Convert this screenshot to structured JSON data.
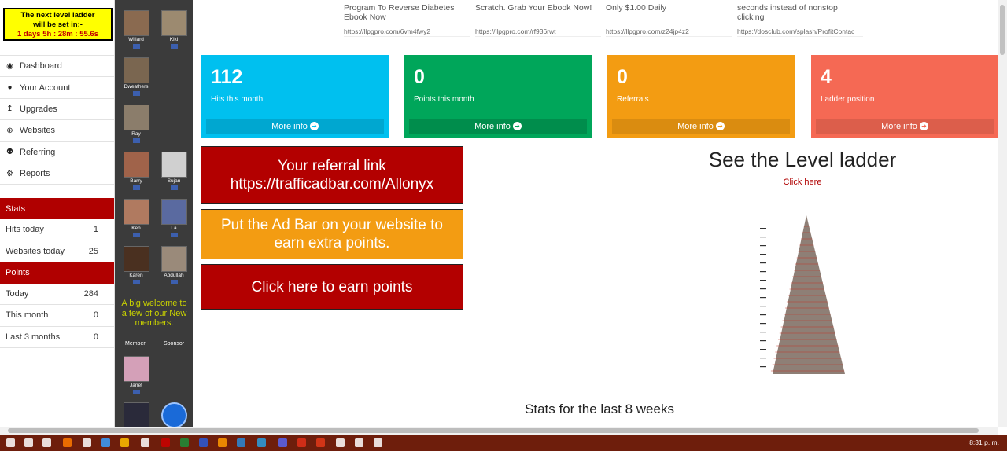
{
  "countdown": {
    "line1": "The next level ladder",
    "line2": "will be set in:-",
    "timer": "1 days 5h : 28m : 55.6s"
  },
  "menu": [
    {
      "label": "Dashboard",
      "icon": "dashboard-icon",
      "glyph": "◉"
    },
    {
      "label": "Your Account",
      "icon": "user-icon",
      "glyph": "●"
    },
    {
      "label": "Upgrades",
      "icon": "upgrade-arrow-icon",
      "glyph": "↥"
    },
    {
      "label": "Websites",
      "icon": "globe-icon",
      "glyph": "⊕"
    },
    {
      "label": "Referring",
      "icon": "users-icon",
      "glyph": "⚉"
    },
    {
      "label": "Reports",
      "icon": "gear-icon",
      "glyph": "⚙"
    }
  ],
  "stats": {
    "heading": "Stats",
    "rows": [
      {
        "label": "Hits today",
        "value": "1"
      },
      {
        "label": "Websites today",
        "value": "25"
      }
    ]
  },
  "points": {
    "heading": "Points",
    "rows": [
      {
        "label": "Today",
        "value": "284"
      },
      {
        "label": "This month",
        "value": "0"
      },
      {
        "label": "Last 3 months",
        "value": "0"
      }
    ]
  },
  "members": [
    {
      "name": "Willard",
      "color": "#8a6a50"
    },
    {
      "name": "Kiki",
      "color": "#9c8a70"
    },
    {
      "name": "Dweathers",
      "color": "#7a6650"
    },
    {
      "name": "Ray",
      "color": "#8b7d6b"
    },
    {
      "name": "Barry",
      "color": "#a0634a"
    },
    {
      "name": "Sujan",
      "color": "#d0d0d0"
    },
    {
      "name": "Ken",
      "color": "#b07a60"
    },
    {
      "name": "La",
      "color": "#5a6aa0"
    },
    {
      "name": "Karen",
      "color": "#4a3020"
    },
    {
      "name": "Abdullah",
      "color": "#9a8a7a"
    },
    {
      "name": "Janet",
      "color": "#d4a0b8"
    }
  ],
  "welcome_text": "A big welcome to a few of our New members.",
  "member_label": "Member",
  "sponsor_label": "Sponsor",
  "ads": [
    {
      "text": "Program To Reverse Diabetes Ebook Now",
      "url": "https://llpgpro.com/6vm4fwy2"
    },
    {
      "text": "Scratch. Grab Your Ebook Now!",
      "url": "https://llpgpro.com/rf936rwt"
    },
    {
      "text": "Only $1.00 Daily",
      "url": "https://llpgpro.com/z24jp4z2"
    },
    {
      "text": "seconds instead of nonstop clicking",
      "url": "https://dosclub.com/splash/ProfitContac"
    }
  ],
  "boxes": [
    {
      "number": "112",
      "label": "Hits this month",
      "more": "More info",
      "bg": "#00c0ef",
      "footer": "#00a7d0"
    },
    {
      "number": "0",
      "label": "Points this month",
      "more": "More info",
      "bg": "#00a65a",
      "footer": "#008d4c"
    },
    {
      "number": "0",
      "label": "Referrals",
      "more": "More info",
      "bg": "#f39c12",
      "footer": "#da8c10"
    },
    {
      "number": "4",
      "label": "Ladder position",
      "more": "More info",
      "bg": "#f56954",
      "footer": "#dc5e4b"
    }
  ],
  "referral": {
    "line1": "Your referral link",
    "line2": "https://trafficadbar.com/Allonyx"
  },
  "adbar_promo": "Put the Ad Bar on your website to earn extra points.",
  "earn_points": "Click here to earn points",
  "ladder": {
    "title": "See the Level ladder",
    "link": "Click here"
  },
  "stats_title": "Stats for the last 8 weeks",
  "clock": "8:31 p. m."
}
